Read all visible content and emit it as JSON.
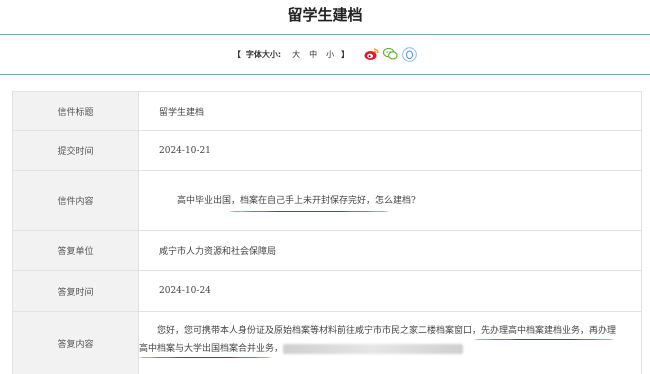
{
  "page": {
    "title": "留学生建档"
  },
  "toolbar": {
    "bracket_open": "【",
    "font_size_label": "字体大小:",
    "sizes": [
      "大",
      "中",
      "小"
    ],
    "bracket_close": "】",
    "share_icons": [
      "weibo-icon",
      "wechat-icon",
      "qq-icon"
    ]
  },
  "colors": {
    "rule": "#7ea7a3",
    "label_bg": "#f2f2f2",
    "underline": "#c8201e"
  },
  "table": {
    "rows": [
      {
        "label": "信件标题",
        "value": "留学生建档"
      },
      {
        "label": "提交时间",
        "value": "2024-10-21"
      },
      {
        "label": "信件内容",
        "value": "高中毕业出国，档案在自己手上未开封保存完好，怎么建档?"
      },
      {
        "label": "答复单位",
        "value": "咸宁市人力资源和社会保障局"
      },
      {
        "label": "答复时间",
        "value": "2024-10-24"
      },
      {
        "label": "答复内容",
        "value_line1": "您好，您可携带本人身份证及原始档案等材料前往咸宁市市民之家二楼档案窗口，先办理高中档案建档业务，再办理",
        "value_line2": "高中档案与大学出国档案合并业务，"
      }
    ]
  }
}
